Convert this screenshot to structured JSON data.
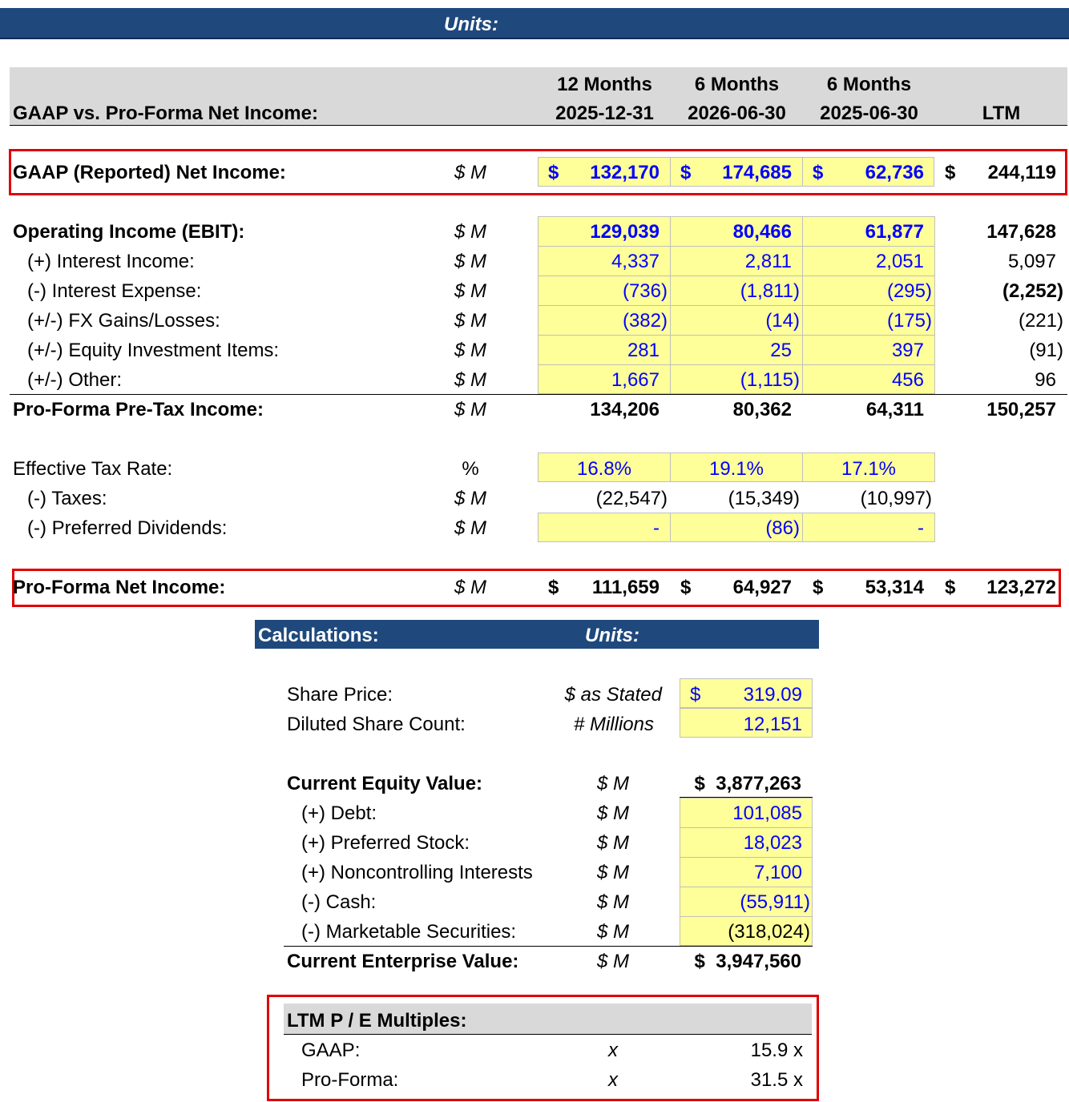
{
  "top_banner": {
    "units_label": "Units:"
  },
  "header": {
    "title": "GAAP vs. Pro-Forma Net Income:",
    "columns": [
      {
        "line1": "12 Months",
        "line2": "2025-12-31"
      },
      {
        "line1": "6 Months",
        "line2": "2026-06-30"
      },
      {
        "line1": "6 Months",
        "line2": "2025-06-30"
      },
      {
        "line1": "",
        "line2": "LTM"
      }
    ]
  },
  "gaap_net_income": {
    "label": "GAAP (Reported) Net Income:",
    "unit": "$ M",
    "currency": "$",
    "values": [
      "132,170",
      "174,685",
      "62,736",
      "244,119"
    ]
  },
  "rows": [
    {
      "label": "Operating Income (EBIT):",
      "unit": "$ M",
      "values": [
        "129,039",
        "80,466",
        "61,877",
        "147,628"
      ]
    },
    {
      "label": "(+) Interest Income:",
      "unit": "$ M",
      "values": [
        "4,337",
        "2,811",
        "2,051",
        "5,097"
      ]
    },
    {
      "label": "(-) Interest Expense:",
      "unit": "$ M",
      "values": [
        "(736)",
        "(1,811)",
        "(295)",
        "(2,252)"
      ]
    },
    {
      "label": "(+/-) FX Gains/Losses:",
      "unit": "$ M",
      "values": [
        "(382)",
        "(14)",
        "(175)",
        "(221)"
      ]
    },
    {
      "label": "(+/-) Equity Investment Items:",
      "unit": "$ M",
      "values": [
        "281",
        "25",
        "397",
        "(91)"
      ]
    },
    {
      "label": "(+/-) Other:",
      "unit": "$ M",
      "values": [
        "1,667",
        "(1,115)",
        "456",
        "96"
      ]
    }
  ],
  "pretax": {
    "label": "Pro-Forma Pre-Tax Income:",
    "unit": "$ M",
    "values": [
      "134,206",
      "80,362",
      "64,311",
      "150,257"
    ]
  },
  "tax_rate": {
    "label": "Effective Tax Rate:",
    "unit": "%",
    "values": [
      "16.8%",
      "19.1%",
      "17.1%"
    ]
  },
  "taxes": {
    "label": "(-) Taxes:",
    "unit": "$ M",
    "values": [
      "(22,547)",
      "(15,349)",
      "(10,997)"
    ]
  },
  "pref_div": {
    "label": "(-) Preferred Dividends:",
    "unit": "$ M",
    "values": [
      "-",
      "(86)",
      "-"
    ]
  },
  "proforma_net_income": {
    "label": "Pro-Forma Net Income:",
    "unit": "$ M",
    "currency": "$",
    "values": [
      "111,659",
      "64,927",
      "53,314",
      "123,272"
    ]
  },
  "calculations": {
    "title": "Calculations:",
    "units_label": "Units:",
    "share_price": {
      "label": "Share Price:",
      "unit": "$ as Stated",
      "currency": "$",
      "value": "319.09"
    },
    "diluted_shares": {
      "label": "Diluted Share Count:",
      "unit": "# Millions",
      "value": "12,151"
    },
    "equity_value": {
      "label": "Current Equity Value:",
      "unit": "$ M",
      "value": "$  3,877,263"
    },
    "bridge": [
      {
        "label": "(+) Debt:",
        "unit": "$ M",
        "value": "101,085"
      },
      {
        "label": "(+) Preferred Stock:",
        "unit": "$ M",
        "value": "18,023"
      },
      {
        "label": "(+) Noncontrolling Interests",
        "unit": "$ M",
        "value": "7,100"
      },
      {
        "label": "(-) Cash:",
        "unit": "$ M",
        "value": "(55,911)"
      },
      {
        "label": "(-) Marketable Securities:",
        "unit": "$ M",
        "value": "(318,024)"
      }
    ],
    "enterprise_value": {
      "label": "Current Enterprise Value:",
      "unit": "$ M",
      "value": "$  3,947,560"
    }
  },
  "pe_multiples": {
    "title": "LTM P / E Multiples:",
    "rows": [
      {
        "label": "GAAP:",
        "unit": "x",
        "value": "15.9 x"
      },
      {
        "label": "Pro-Forma:",
        "unit": "x",
        "value": "31.5 x"
      }
    ]
  },
  "colors": {
    "header_blue": "#1f497d",
    "input_yellow": "#ffff99",
    "input_text_blue": "#0000ff",
    "highlight_red": "#e00000",
    "header_gray": "#d9d9d9"
  }
}
